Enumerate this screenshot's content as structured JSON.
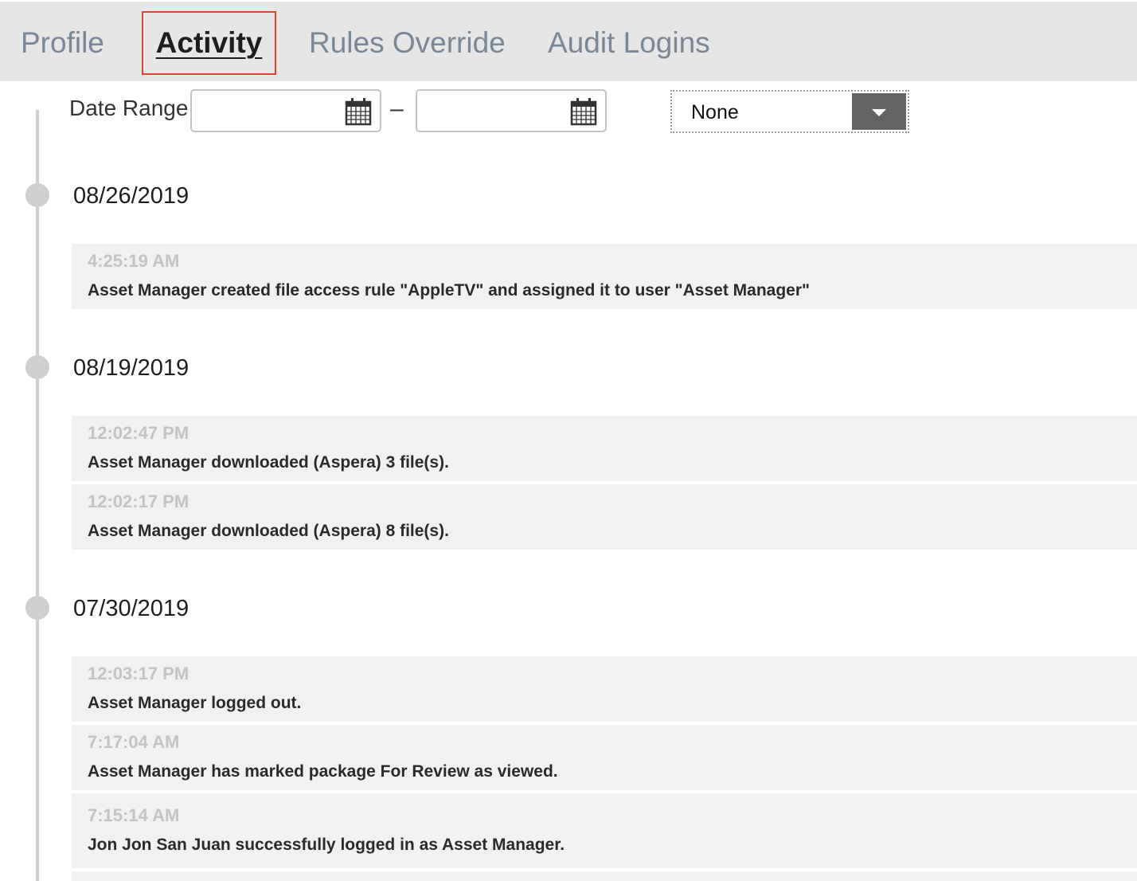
{
  "tabs": [
    {
      "label": "Profile"
    },
    {
      "label": "Activity",
      "active": true
    },
    {
      "label": "Rules Override"
    },
    {
      "label": "Audit Logins"
    }
  ],
  "filter": {
    "label": "Date Range",
    "from_value": "",
    "to_value": "",
    "separator": "–",
    "select_value": "None"
  },
  "groups": [
    {
      "date": "08/26/2019",
      "entries": [
        {
          "time": "4:25:19 AM",
          "message": "Asset Manager created file access rule \"AppleTV\" and assigned it to user \"Asset Manager\""
        }
      ]
    },
    {
      "date": "08/19/2019",
      "entries": [
        {
          "time": "12:02:47 PM",
          "message": "Asset Manager downloaded (Aspera) 3 file(s)."
        },
        {
          "time": "12:02:17 PM",
          "message": "Asset Manager downloaded (Aspera) 8 file(s)."
        }
      ]
    },
    {
      "date": "07/30/2019",
      "entries": [
        {
          "time": "12:03:17 PM",
          "message": "Asset Manager logged out."
        },
        {
          "time": "7:17:04 AM",
          "message": "Asset Manager has marked package For Review as viewed."
        },
        {
          "time": "7:15:14 AM",
          "message": "Jon Jon San Juan successfully logged in as Asset Manager."
        }
      ]
    }
  ],
  "colors": {
    "tab_bar": "#e6e6e6",
    "tab_inactive": "#7a8797",
    "active_outline": "#e0432e",
    "entry_bg": "#f1f1f2",
    "timeline": "#cfcfcf"
  }
}
